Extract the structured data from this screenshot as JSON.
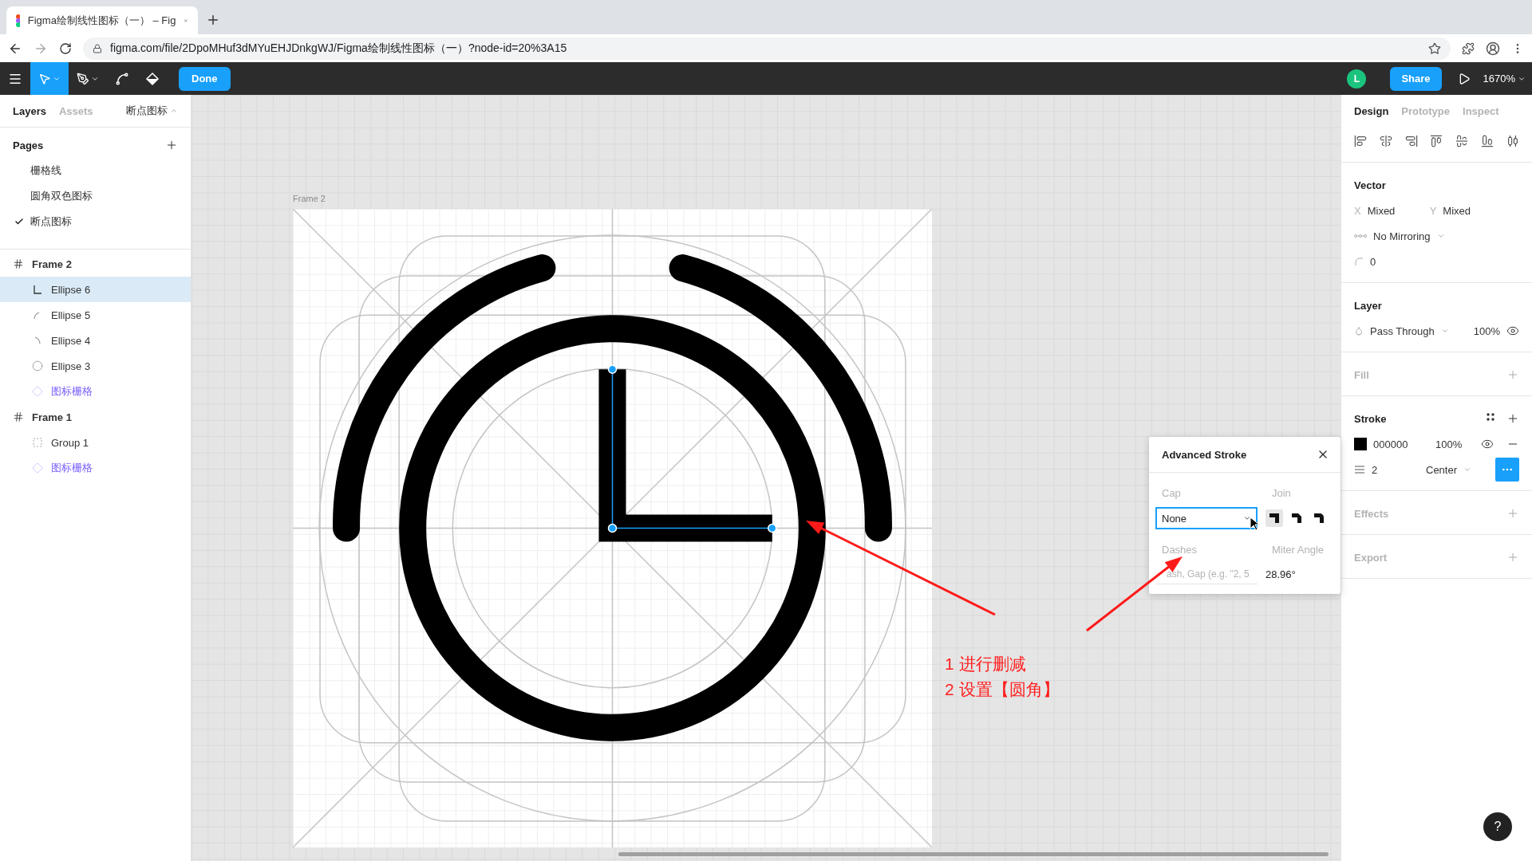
{
  "browser": {
    "tab_title": "Figma绘制线性图标（一） – Fig",
    "url": "figma.com/file/2DpoMHuf3dMYuEHJDnkgWJ/Figma绘制线性图标（一）?node-id=20%3A15"
  },
  "toolbar": {
    "done_button": "Done",
    "avatar_initial": "L",
    "share_button": "Share",
    "zoom": "1670%"
  },
  "left_panel": {
    "tabs": [
      {
        "label": "Layers",
        "selected": true
      },
      {
        "label": "Assets",
        "selected": false
      }
    ],
    "page_selector": "断点图标",
    "pages_title": "Pages",
    "pages": [
      {
        "label": "栅格线",
        "selected": false
      },
      {
        "label": "圆角双色图标",
        "selected": false
      },
      {
        "label": "断点图标",
        "selected": true
      }
    ],
    "layers": [
      {
        "name": "Frame 2",
        "kind": "frame",
        "selected": false,
        "children": [
          {
            "name": "Ellipse 6",
            "kind": "corner",
            "selected": true
          },
          {
            "name": "Ellipse 5",
            "kind": "arc-left",
            "selected": false
          },
          {
            "name": "Ellipse 4",
            "kind": "arc-right",
            "selected": false
          },
          {
            "name": "Ellipse 3",
            "kind": "circle",
            "selected": false
          },
          {
            "name": "图标栅格",
            "kind": "component",
            "selected": false
          }
        ]
      },
      {
        "name": "Frame 1",
        "kind": "frame",
        "selected": false,
        "children": [
          {
            "name": "Group 1",
            "kind": "group",
            "selected": false
          },
          {
            "name": "图标栅格",
            "kind": "component",
            "selected": false
          }
        ]
      }
    ]
  },
  "canvas": {
    "frame_label": "Frame 2"
  },
  "right_panel": {
    "tabs": [
      {
        "label": "Design",
        "selected": true
      },
      {
        "label": "Prototype",
        "selected": false
      },
      {
        "label": "Inspect",
        "selected": false
      }
    ],
    "vector": {
      "title": "Vector",
      "x_label": "X",
      "x_value": "Mixed",
      "y_label": "Y",
      "y_value": "Mixed",
      "mirroring": "No Mirroring",
      "corner_radius": "0"
    },
    "layer": {
      "title": "Layer",
      "blend": "Pass Through",
      "opacity": "100%"
    },
    "fill": {
      "title": "Fill"
    },
    "stroke": {
      "title": "Stroke",
      "color_hex": "000000",
      "opacity": "100%",
      "weight": "2",
      "align": "Center"
    },
    "effects": {
      "title": "Effects"
    },
    "export": {
      "title": "Export"
    }
  },
  "advanced_stroke": {
    "title": "Advanced Stroke",
    "cap_label": "Cap",
    "cap_value": "None",
    "join_label": "Join",
    "joins": [
      {
        "kind": "miter",
        "selected": true
      },
      {
        "kind": "bevel",
        "selected": false
      },
      {
        "kind": "round",
        "selected": false
      }
    ],
    "dashes_label": "Dashes",
    "dashes_placeholder": "ash, Gap (e.g. \"2, 5",
    "miter_label": "Miter Angle",
    "miter_value": "28.96°"
  },
  "annotation": [
    "1 进行删减",
    "2 设置【圆角】"
  ],
  "help_button": "?"
}
